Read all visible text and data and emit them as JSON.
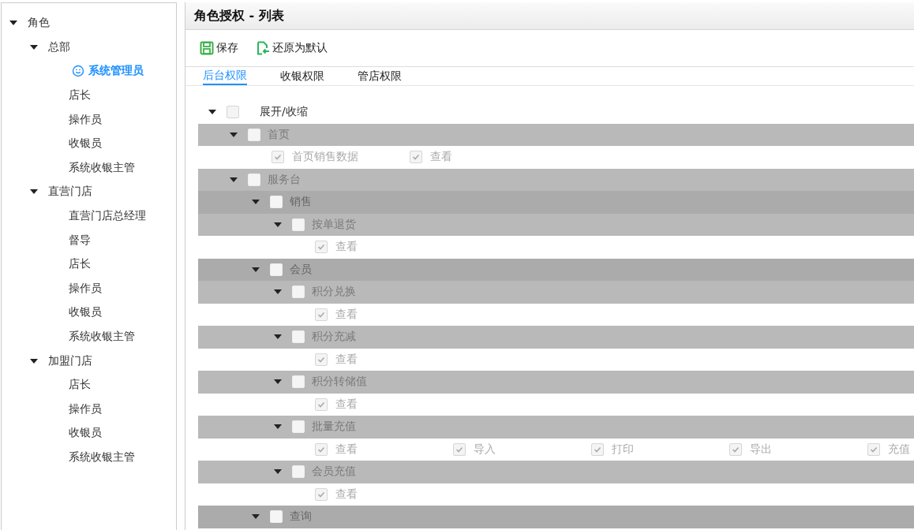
{
  "sidebar": {
    "tree": [
      {
        "label": "角色",
        "expanded": true,
        "children": [
          {
            "label": "总部",
            "expanded": true,
            "children": [
              {
                "label": "系统管理员",
                "selected": true
              },
              {
                "label": "店长",
                "selected": false
              },
              {
                "label": "操作员",
                "selected": false
              },
              {
                "label": "收银员",
                "selected": false
              },
              {
                "label": "系统收银主管",
                "selected": false
              }
            ]
          },
          {
            "label": "直营门店",
            "expanded": true,
            "children": [
              {
                "label": "直营门店总经理",
                "selected": false
              },
              {
                "label": "督导",
                "selected": false
              },
              {
                "label": "店长",
                "selected": false
              },
              {
                "label": "操作员",
                "selected": false
              },
              {
                "label": "收银员",
                "selected": false
              },
              {
                "label": "系统收银主管",
                "selected": false
              }
            ]
          },
          {
            "label": "加盟门店",
            "expanded": true,
            "children": [
              {
                "label": "店长",
                "selected": false
              },
              {
                "label": "操作员",
                "selected": false
              },
              {
                "label": "收银员",
                "selected": false
              },
              {
                "label": "系统收银主管",
                "selected": false
              }
            ]
          }
        ]
      }
    ]
  },
  "panel": {
    "title": "角色授权 - 列表",
    "toolbar": [
      {
        "kind": "save",
        "label": "保存"
      },
      {
        "kind": "restore",
        "label": "还原为默认"
      }
    ],
    "tabs": [
      {
        "label": "后台权限",
        "selected": true
      },
      {
        "label": "收银权限",
        "selected": false
      },
      {
        "label": "管店权限",
        "selected": false
      }
    ]
  },
  "permissions": {
    "label": "展开/收缩",
    "expanded": true,
    "checked": false,
    "nodes": [
      {
        "label": "首页",
        "expanded": true,
        "checked": false,
        "actions": [
          {
            "label": "首页销售数据",
            "checked": true
          },
          {
            "label": "查看",
            "checked": true
          }
        ]
      },
      {
        "label": "服务台",
        "expanded": true,
        "checked": false,
        "children": [
          {
            "label": "销售",
            "expanded": true,
            "checked": false,
            "children": [
              {
                "label": "按单退货",
                "expanded": true,
                "checked": false,
                "actions": [
                  {
                    "label": "查看",
                    "checked": true
                  }
                ]
              }
            ]
          },
          {
            "label": "会员",
            "expanded": true,
            "checked": false,
            "children": [
              {
                "label": "积分兑换",
                "expanded": true,
                "checked": false,
                "actions": [
                  {
                    "label": "查看",
                    "checked": true
                  }
                ]
              },
              {
                "label": "积分充减",
                "expanded": true,
                "checked": false,
                "actions": [
                  {
                    "label": "查看",
                    "checked": true
                  }
                ]
              },
              {
                "label": "积分转储值",
                "expanded": true,
                "checked": false,
                "actions": [
                  {
                    "label": "查看",
                    "checked": true
                  }
                ]
              },
              {
                "label": "批量充值",
                "expanded": true,
                "checked": false,
                "actions": [
                  {
                    "label": "查看",
                    "checked": true
                  },
                  {
                    "label": "导入",
                    "checked": true
                  },
                  {
                    "label": "打印",
                    "checked": true
                  },
                  {
                    "label": "导出",
                    "checked": true
                  },
                  {
                    "label": "充值",
                    "checked": true
                  }
                ]
              },
              {
                "label": "会员充值",
                "expanded": true,
                "checked": false,
                "actions": [
                  {
                    "label": "查看",
                    "checked": true
                  }
                ]
              }
            ]
          },
          {
            "label": "查询",
            "expanded": true,
            "checked": false
          }
        ]
      }
    ]
  }
}
